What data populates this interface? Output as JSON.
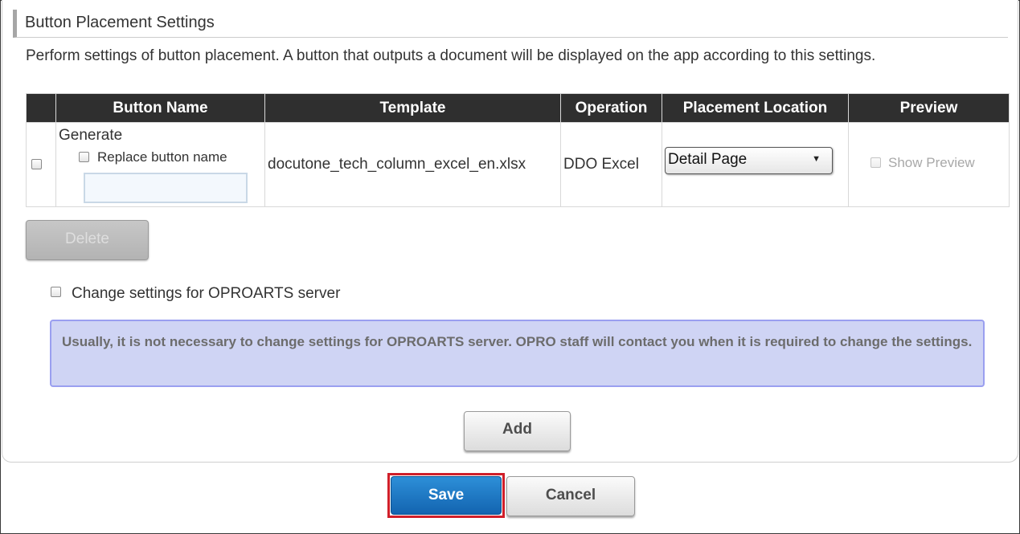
{
  "section": {
    "title": "Button Placement Settings",
    "description": "Perform settings of button placement. A button that outputs a document will be displayed on the app according to this settings."
  },
  "table": {
    "headers": {
      "select": "",
      "button_name": "Button Name",
      "template": "Template",
      "operation": "Operation",
      "placement_location": "Placement Location",
      "preview": "Preview"
    },
    "rows": [
      {
        "selected": false,
        "button_name": "Generate",
        "replace_label": "Replace button name",
        "replace_checked": false,
        "replace_value": "",
        "template": "docutone_tech_column_excel_en.xlsx",
        "operation": "DDO Excel",
        "placement_location": "Detail Page",
        "show_preview_label": "Show Preview",
        "show_preview_checked": false
      }
    ]
  },
  "buttons": {
    "delete": "Delete",
    "add": "Add",
    "save": "Save",
    "cancel": "Cancel"
  },
  "oproarts": {
    "checkbox_label": "Change settings for OPROARTS server",
    "checked": false,
    "notice": "Usually, it is not necessary to change settings for OPROARTS server. OPRO staff will contact you when it is required to change the settings."
  },
  "colors": {
    "header_bg": "#2f2f2f",
    "notice_bg": "#cfd4f4",
    "notice_border": "#9a9ff0",
    "save_bg": "#1a73c4",
    "highlight": "#d01f2a"
  }
}
